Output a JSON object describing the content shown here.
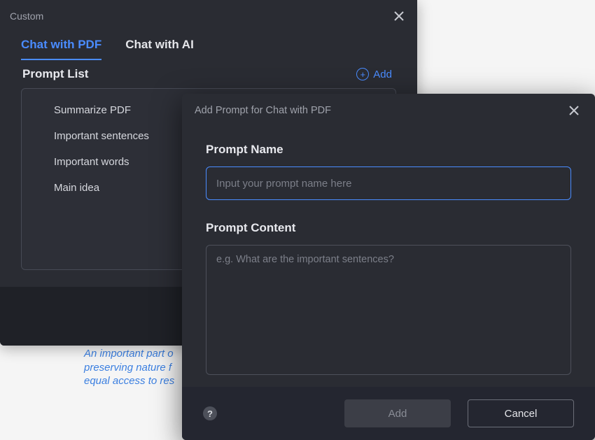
{
  "custom_panel": {
    "title": "Custom",
    "tabs": [
      {
        "label": "Chat with PDF",
        "active": true
      },
      {
        "label": "Chat with AI",
        "active": false
      }
    ],
    "prompt_list_heading": "Prompt List",
    "add_label": "Add",
    "items": [
      {
        "label": "Summarize PDF"
      },
      {
        "label": "Important sentences"
      },
      {
        "label": "Important words"
      },
      {
        "label": "Main idea"
      }
    ]
  },
  "add_modal": {
    "title": "Add Prompt for Chat with PDF",
    "name_label": "Prompt Name",
    "name_placeholder": "Input your prompt name here",
    "name_value": "",
    "content_label": "Prompt Content",
    "content_placeholder": "e.g. What are the important sentences?",
    "content_value": "",
    "add_button": "Add",
    "cancel_button": "Cancel",
    "help_glyph": "?"
  },
  "background_doc": {
    "line1": "An important part o",
    "line2": "preserving nature f",
    "line3": "equal access to res"
  },
  "icons": {
    "close": "close-icon",
    "plus": "plus-circle-icon",
    "help": "help-icon"
  }
}
